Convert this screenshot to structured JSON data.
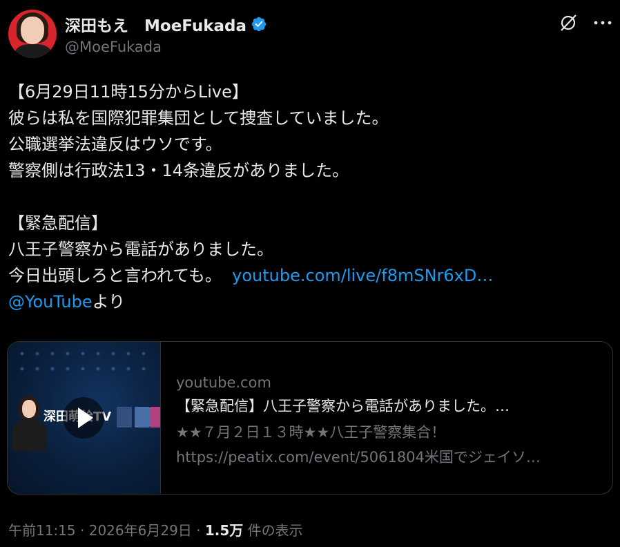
{
  "author": {
    "display_name": "深田もえ　MoeFukada",
    "handle": "@MoeFukada",
    "verified": true
  },
  "tweet": {
    "lines": [
      "【6月29日11時15分からLive】",
      "彼らは私を国際犯罪集団として捜査していました。",
      "公職選挙法違反はウソです。",
      "警察側は行政法13・14条違反がありました。",
      "",
      "【緊急配信】",
      "八王子警察から電話がありました。",
      "今日出頭しろと言われても。"
    ],
    "link_text": "youtube.com/live/f8mSNr6xD…",
    "mention": "@YouTube",
    "mention_suffix": "より"
  },
  "card": {
    "domain": "youtube.com",
    "title": "【緊急配信】八王子警察から電話がありました。…",
    "desc_line1": "★★７月２日１３時★★八王子警察集合！",
    "desc_line2": "https://peatix.com/event/5061804米国でジェイソ…",
    "thumb_text": "深田萌絵TV"
  },
  "meta": {
    "time": "午前11:15",
    "date": "2026年6月29日",
    "views": "1.5万",
    "views_label": "件の表示",
    "separator": "·"
  },
  "colors": {
    "background": "#000000",
    "text": "#e7e9ea",
    "secondary": "#71767b",
    "link": "#1d9bf0",
    "verified": "#1d9bf0",
    "border": "#2f3336"
  },
  "icons": [
    "verified-badge-icon",
    "grok-icon",
    "more-icon",
    "play-icon"
  ]
}
